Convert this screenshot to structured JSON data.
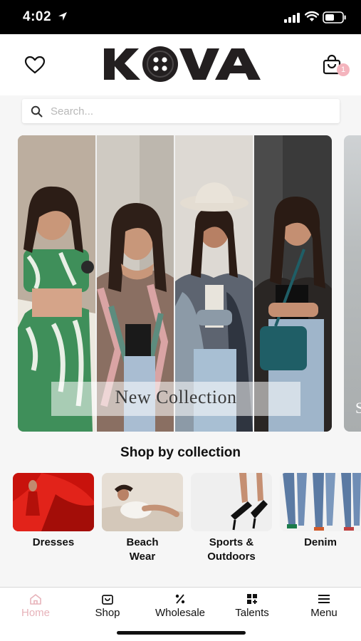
{
  "status_bar": {
    "time": "4:02",
    "icons": [
      "location-arrow-icon",
      "signal-icon",
      "wifi-icon",
      "battery-icon"
    ]
  },
  "header": {
    "logo_text": "KOVA",
    "wishlist_icon": "heart-icon",
    "cart_icon": "shopping-bag-icon",
    "cart_count": "1"
  },
  "search": {
    "placeholder": "Search...",
    "icon": "search-icon"
  },
  "hero": {
    "caption": "New Collection",
    "next_slide_letter": "S"
  },
  "collections": {
    "title": "Shop by collection",
    "items": [
      {
        "label": "Dresses"
      },
      {
        "label": "Beach\nWear"
      },
      {
        "label": "Sports &\nOutdoors"
      },
      {
        "label": "Denim"
      }
    ]
  },
  "bottom_nav": {
    "items": [
      {
        "label": "Home",
        "icon": "home-icon",
        "active": true
      },
      {
        "label": "Shop",
        "icon": "shopping-bag-icon",
        "active": false
      },
      {
        "label": "Wholesale",
        "icon": "percent-icon",
        "active": false
      },
      {
        "label": "Talents",
        "icon": "grid-plus-icon",
        "active": false
      },
      {
        "label": "Menu",
        "icon": "hamburger-menu-icon",
        "active": false
      }
    ]
  },
  "colors": {
    "accent": "#e7b3ba",
    "text": "#111111",
    "background": "#f6f6f6"
  }
}
